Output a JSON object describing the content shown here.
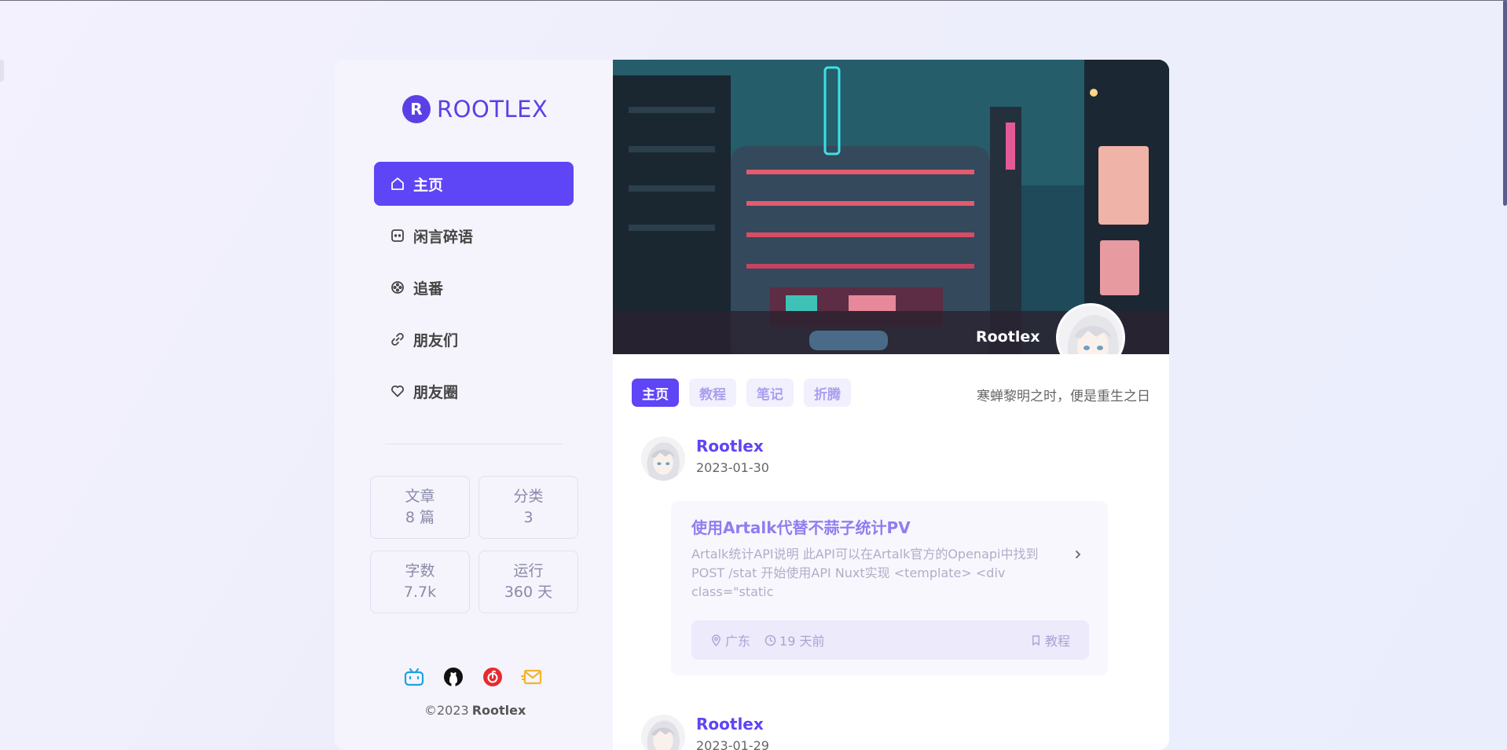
{
  "brand": {
    "badge": "R",
    "name": "ROOTLEX",
    "accent": "#5e45f5"
  },
  "nav": [
    {
      "label": "主页",
      "icon": "home-icon",
      "active": true
    },
    {
      "label": "闲言碎语",
      "icon": "chat-icon",
      "active": false
    },
    {
      "label": "追番",
      "icon": "film-icon",
      "active": false
    },
    {
      "label": "朋友们",
      "icon": "link-icon",
      "active": false
    },
    {
      "label": "朋友圈",
      "icon": "heart-icon",
      "active": false
    }
  ],
  "stats": [
    {
      "label": "文章",
      "value": "8 篇"
    },
    {
      "label": "分类",
      "value": "3"
    },
    {
      "label": "字数",
      "value": "7.7k"
    },
    {
      "label": "运行",
      "value": "360 天"
    }
  ],
  "socials": [
    "bilibili-icon",
    "github-icon",
    "netease-music-icon",
    "mail-icon"
  ],
  "footer": {
    "copyright": "©2023",
    "owner": "Rootlex"
  },
  "hero": {
    "name": "Rootlex"
  },
  "tabs": [
    {
      "label": "主页",
      "active": true
    },
    {
      "label": "教程",
      "active": false
    },
    {
      "label": "笔记",
      "active": false
    },
    {
      "label": "折腾",
      "active": false
    }
  ],
  "motto": "寒蝉黎明之时，便是重生之日",
  "posts": [
    {
      "author": "Rootlex",
      "date": "2023-01-30",
      "title": "使用Artalk代替不蒜子统计PV",
      "excerpt": "Artalk统计API说明 此API可以在Artalk官方的Openapi中找到 POST /stat 开始使用API Nuxt实现 <template> <div class=\"static",
      "location": "广东",
      "time_ago": "19 天前",
      "category": "教程"
    },
    {
      "author": "Rootlex",
      "date": "2023-01-29"
    }
  ]
}
